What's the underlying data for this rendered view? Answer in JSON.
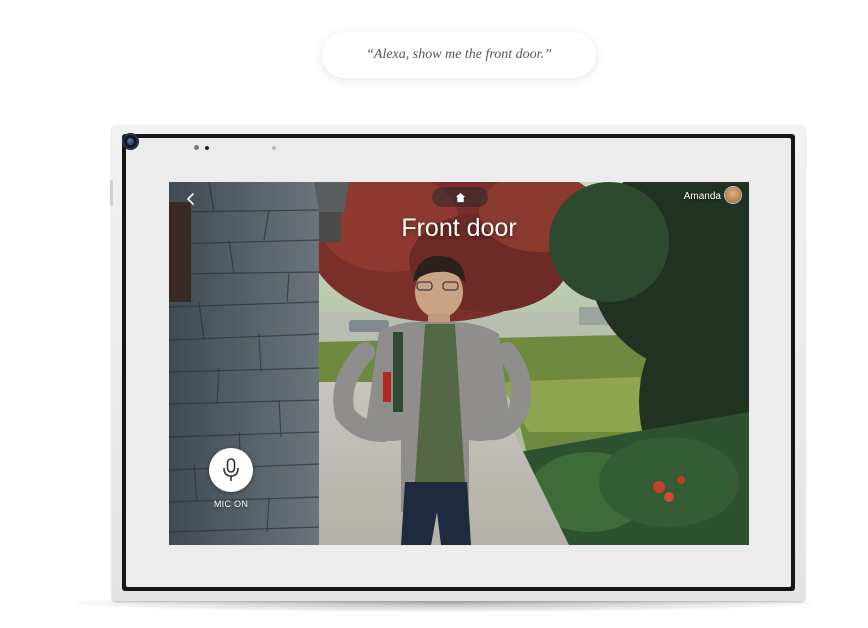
{
  "prompt": {
    "text": "“Alexa, show me the front door.”"
  },
  "screen": {
    "title": "Front door",
    "back_icon": "chevron-left-icon",
    "home_icon": "home-icon",
    "user": {
      "name": "Amanda"
    },
    "mic": {
      "label": "MIC ON",
      "icon": "microphone-icon"
    }
  },
  "colors": {
    "overlay_text": "#ffffff",
    "mic_button_bg": "#ffffff",
    "device_frame": "#ececec",
    "bezel": "#161616"
  }
}
